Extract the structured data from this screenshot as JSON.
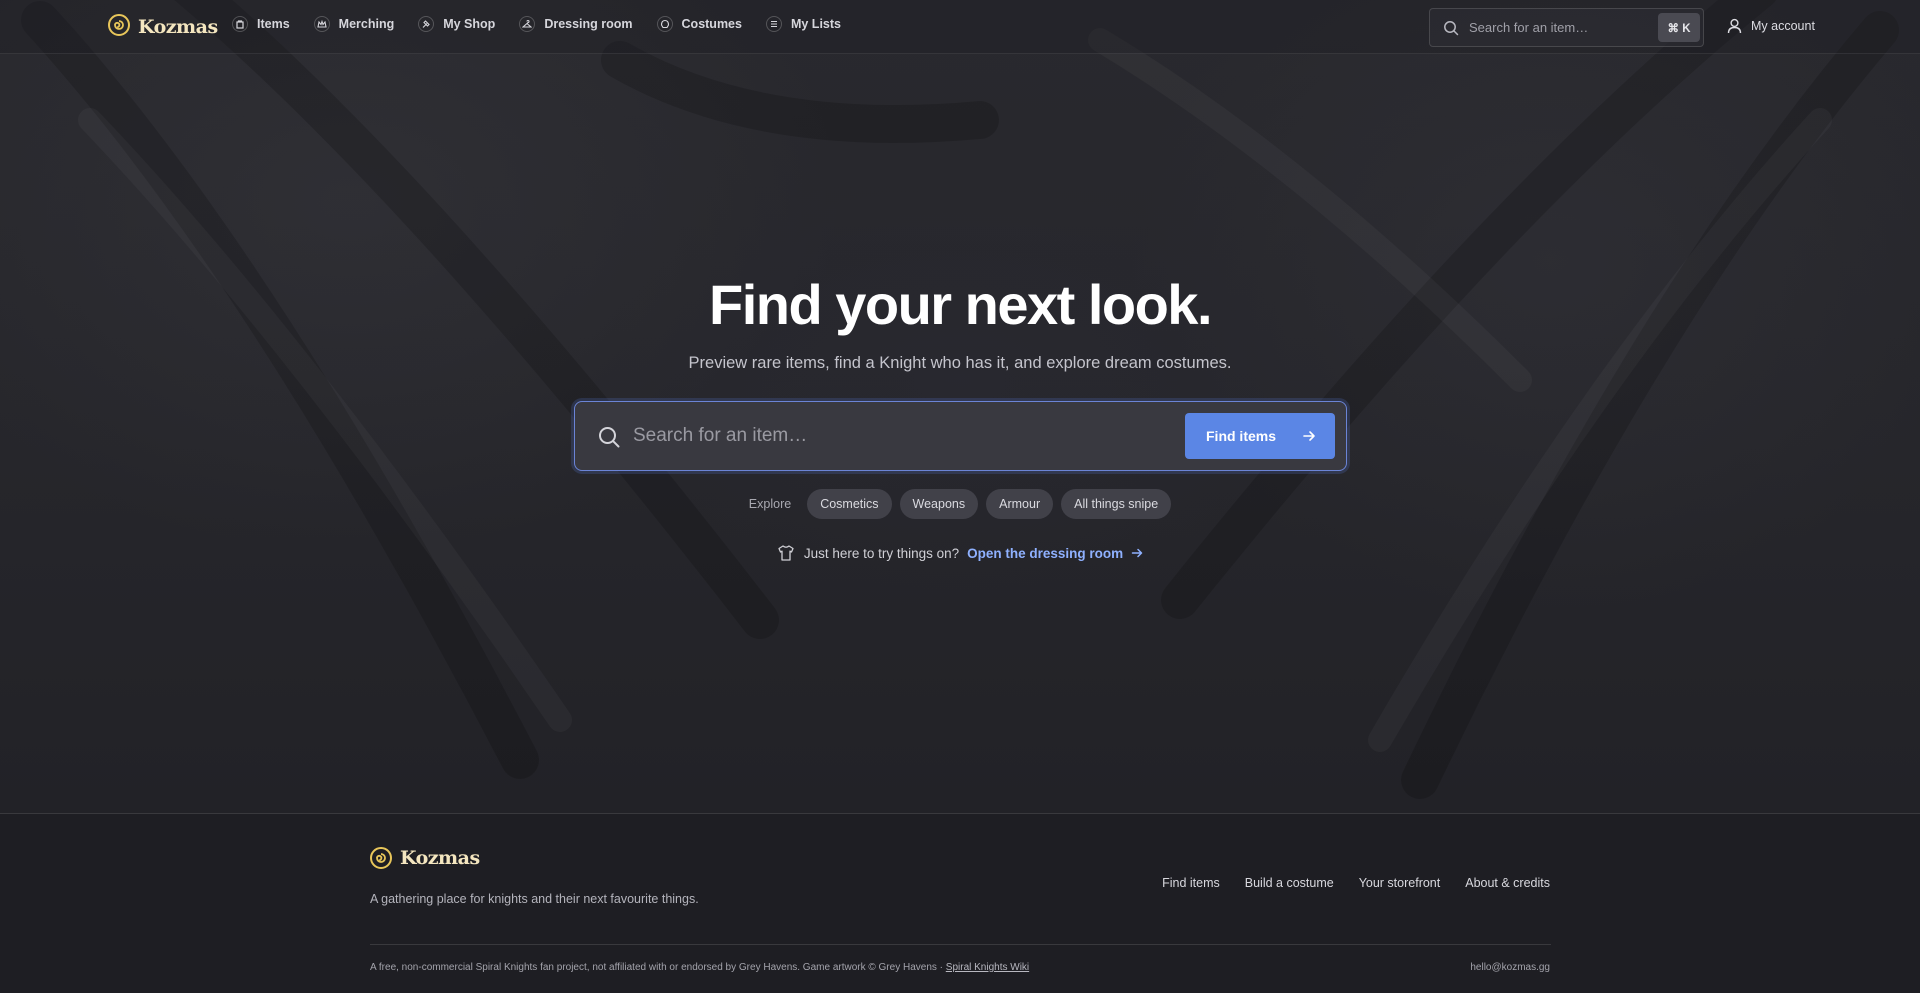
{
  "brand": {
    "name": "Kozmas",
    "logo_icon": "spiral-icon",
    "accent": "#e8c65a"
  },
  "nav": {
    "items": [
      {
        "label": "Items",
        "icon": "bag-icon"
      },
      {
        "label": "Merching",
        "icon": "crown-icon"
      },
      {
        "label": "My Shop",
        "icon": "hammer-icon"
      },
      {
        "label": "Dressing room",
        "icon": "hanger-icon"
      },
      {
        "label": "Costumes",
        "icon": "helmet-icon"
      },
      {
        "label": "My Lists",
        "icon": "list-icon"
      }
    ],
    "search_placeholder": "Search for an item…",
    "shortcut": "⌘ K",
    "account_label": "My account"
  },
  "hero": {
    "title": "Find your next look.",
    "subtitle": "Preview rare items, find a Knight who has it, and explore dream costumes.",
    "search_placeholder": "Search for an item…",
    "find_button": "Find items",
    "explore_label": "Explore",
    "chips": [
      "Cosmetics",
      "Weapons",
      "Armour",
      "All things snipe"
    ],
    "tryon_text": "Just here to try things on?",
    "tryon_link": "Open the dressing room",
    "button_color": "#5b86e5",
    "link_color": "#8fb1ff"
  },
  "footer": {
    "brand": "Kozmas",
    "tagline": "A gathering place for knights and their next favourite things.",
    "links": [
      "Find items",
      "Build a costume",
      "Your storefront",
      "About & credits"
    ],
    "legal": "A free, non-commercial Spiral Knights fan project, not affiliated with or endorsed by Grey Havens. Game artwork © Grey Havens · ",
    "wiki_link": "Spiral Knights Wiki",
    "email": "hello@kozmas.gg"
  }
}
